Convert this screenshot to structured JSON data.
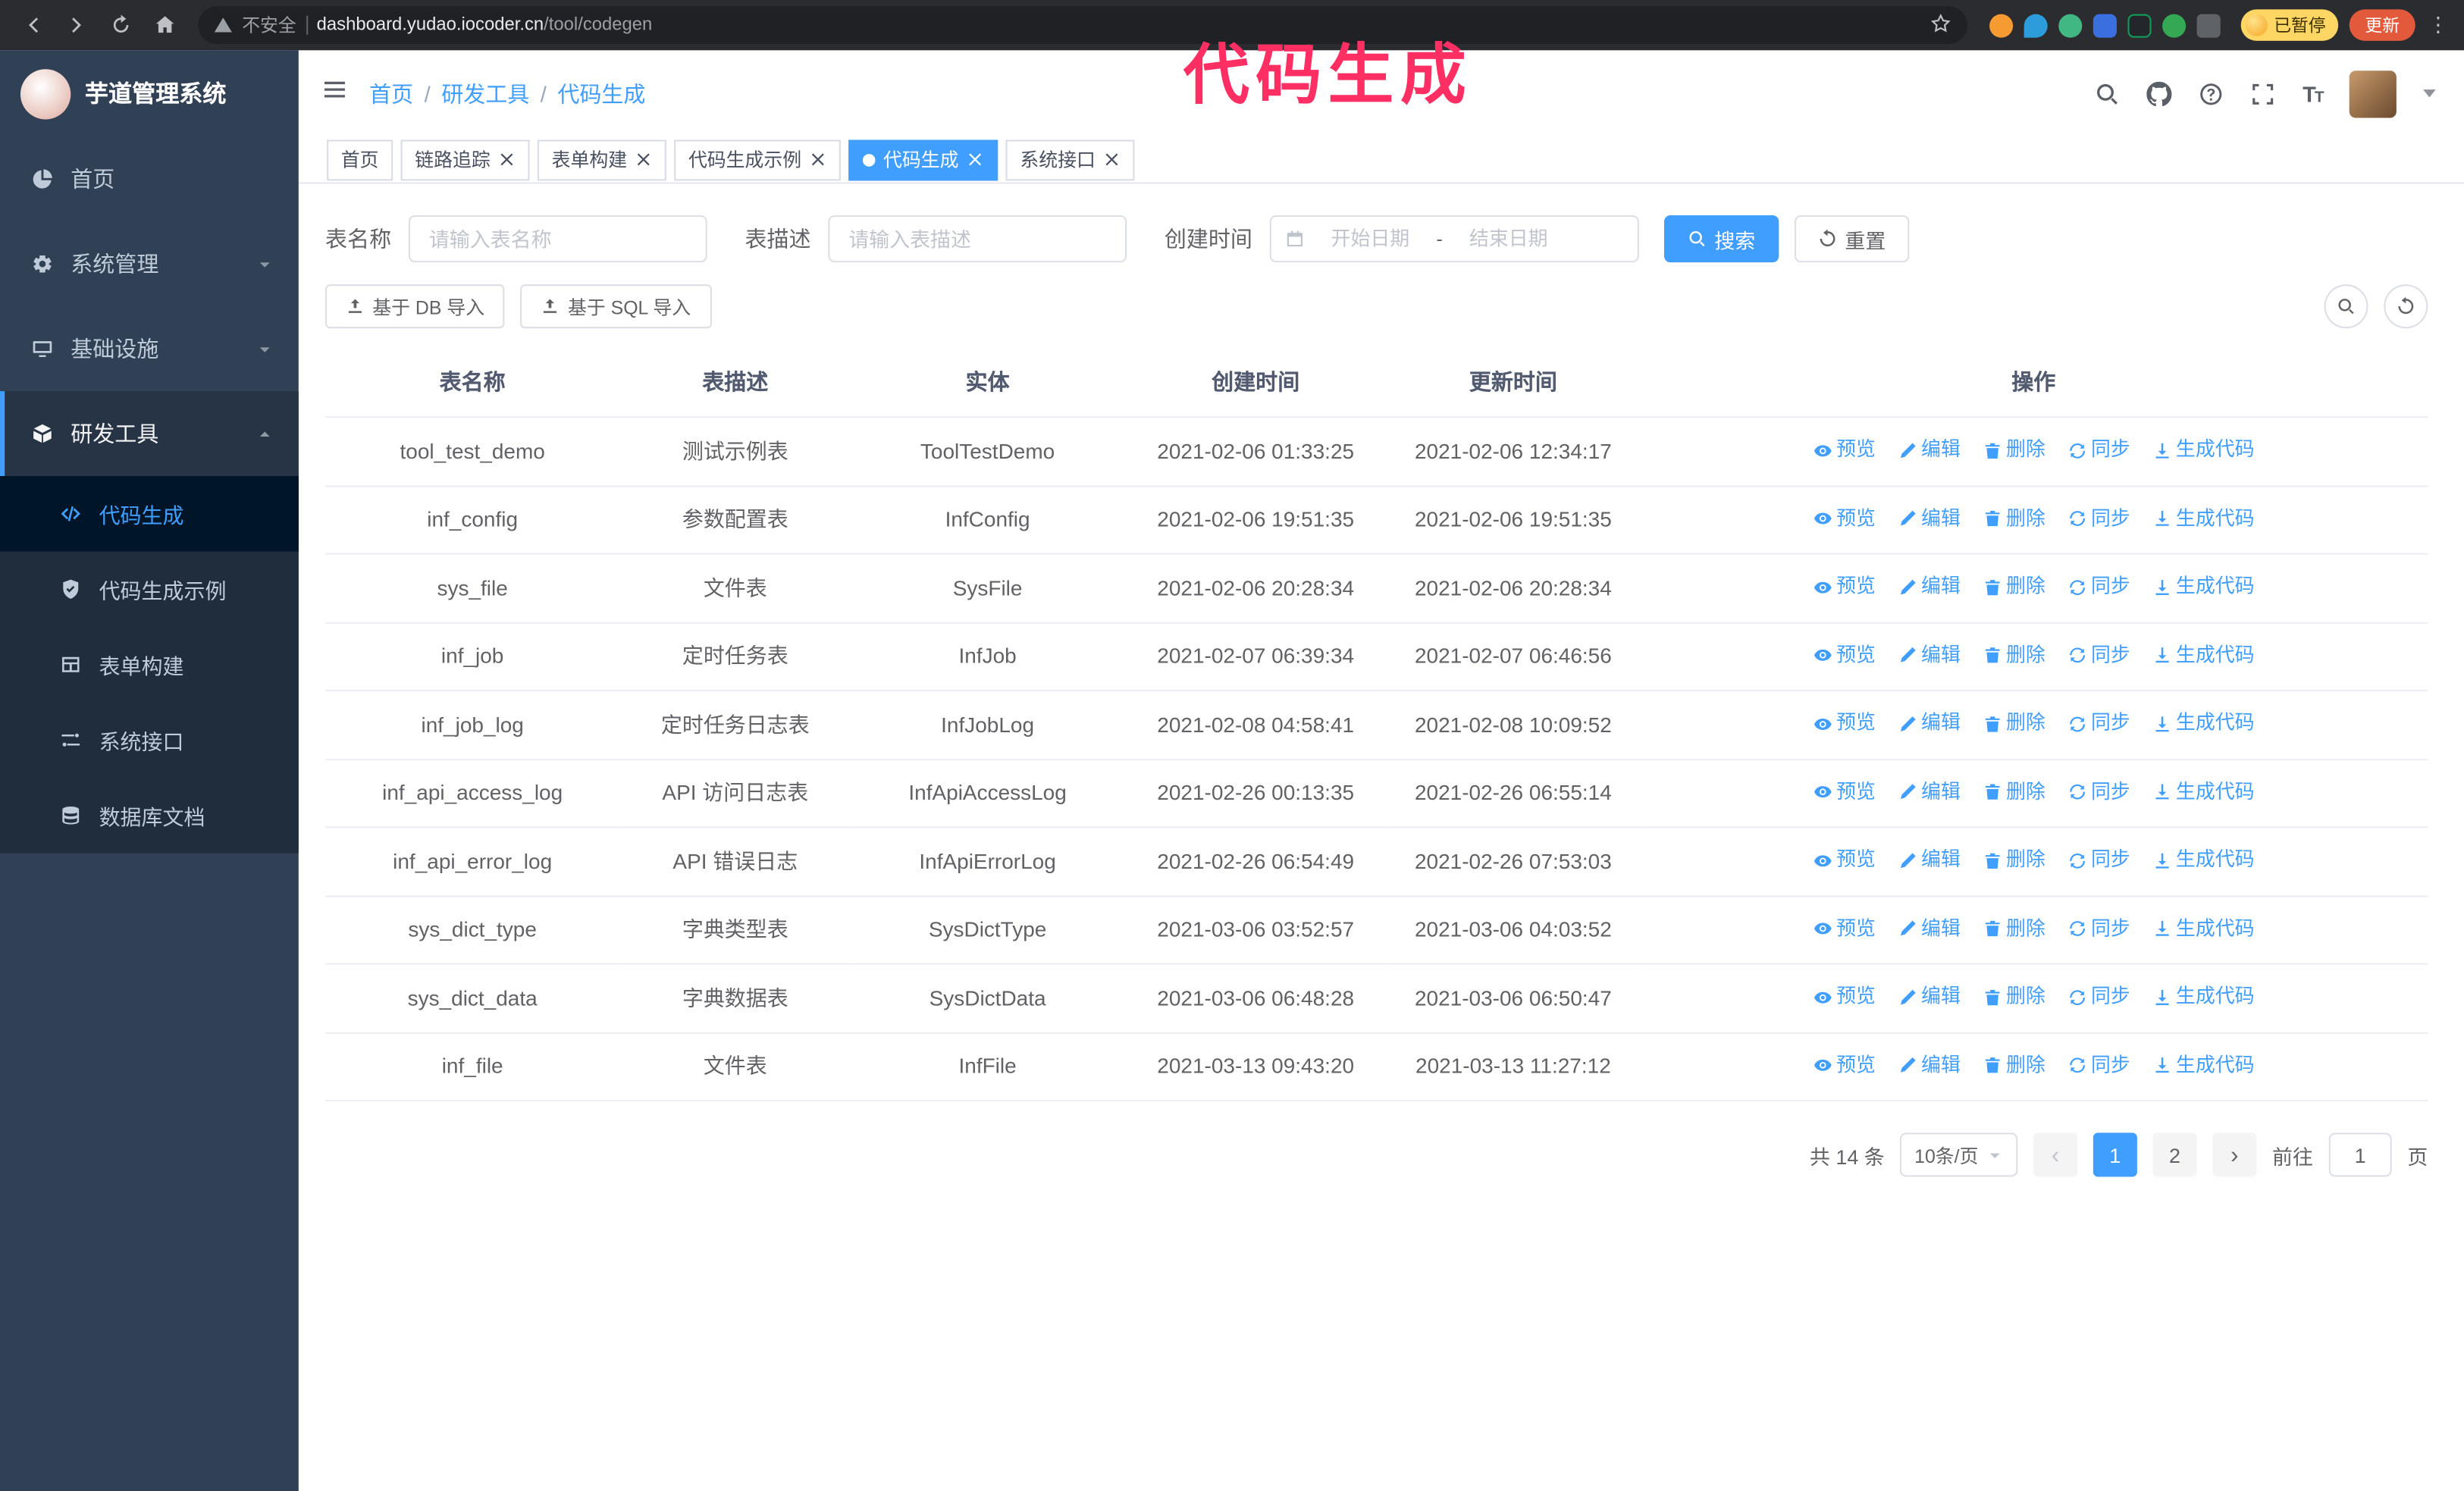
{
  "annotation": {
    "text": "代码生成"
  },
  "browser": {
    "security_label": "不安全",
    "url_domain": "dashboard.yudao.iocoder.cn",
    "url_path": "/tool/codegen",
    "paused_badge": "已暂停",
    "update_button": "更新"
  },
  "sidebar": {
    "logo_title": "芋道管理系统",
    "items": [
      {
        "label": "首页"
      },
      {
        "label": "系统管理"
      },
      {
        "label": "基础设施"
      },
      {
        "label": "研发工具"
      }
    ],
    "submenu": [
      {
        "label": "代码生成"
      },
      {
        "label": "代码生成示例"
      },
      {
        "label": "表单构建"
      },
      {
        "label": "系统接口"
      },
      {
        "label": "数据库文档"
      }
    ]
  },
  "header": {
    "breadcrumb": [
      "首页",
      "研发工具",
      "代码生成"
    ]
  },
  "tabs": [
    {
      "label": "首页"
    },
    {
      "label": "链路追踪"
    },
    {
      "label": "表单构建"
    },
    {
      "label": "代码生成示例"
    },
    {
      "label": "代码生成"
    },
    {
      "label": "系统接口"
    }
  ],
  "filters": {
    "table_name_label": "表名称",
    "table_name_placeholder": "请输入表名称",
    "table_desc_label": "表描述",
    "table_desc_placeholder": "请输入表描述",
    "create_time_label": "创建时间",
    "date_start_placeholder": "开始日期",
    "date_separator": "-",
    "date_end_placeholder": "结束日期",
    "search_button": "搜索",
    "reset_button": "重置"
  },
  "toolbar": {
    "import_db_button": "基于 DB 导入",
    "import_sql_button": "基于 SQL 导入"
  },
  "table": {
    "columns": [
      "表名称",
      "表描述",
      "实体",
      "创建时间",
      "更新时间",
      "操作"
    ],
    "actions": [
      "预览",
      "编辑",
      "删除",
      "同步",
      "生成代码"
    ],
    "rows": [
      {
        "name": "tool_test_demo",
        "desc": "测试示例表",
        "entity": "ToolTestDemo",
        "created": "2021-02-06 01:33:25",
        "updated": "2021-02-06 12:34:17"
      },
      {
        "name": "inf_config",
        "desc": "参数配置表",
        "entity": "InfConfig",
        "created": "2021-02-06 19:51:35",
        "updated": "2021-02-06 19:51:35"
      },
      {
        "name": "sys_file",
        "desc": "文件表",
        "entity": "SysFile",
        "created": "2021-02-06 20:28:34",
        "updated": "2021-02-06 20:28:34"
      },
      {
        "name": "inf_job",
        "desc": "定时任务表",
        "entity": "InfJob",
        "created": "2021-02-07 06:39:34",
        "updated": "2021-02-07 06:46:56"
      },
      {
        "name": "inf_job_log",
        "desc": "定时任务日志表",
        "entity": "InfJobLog",
        "created": "2021-02-08 04:58:41",
        "updated": "2021-02-08 10:09:52"
      },
      {
        "name": "inf_api_access_log",
        "desc": "API 访问日志表",
        "entity": "InfApiAccessLog",
        "created": "2021-02-26 00:13:35",
        "updated": "2021-02-26 06:55:14"
      },
      {
        "name": "inf_api_error_log",
        "desc": "API 错误日志",
        "entity": "InfApiErrorLog",
        "created": "2021-02-26 06:54:49",
        "updated": "2021-02-26 07:53:03"
      },
      {
        "name": "sys_dict_type",
        "desc": "字典类型表",
        "entity": "SysDictType",
        "created": "2021-03-06 03:52:57",
        "updated": "2021-03-06 04:03:52"
      },
      {
        "name": "sys_dict_data",
        "desc": "字典数据表",
        "entity": "SysDictData",
        "created": "2021-03-06 06:48:28",
        "updated": "2021-03-06 06:50:47"
      },
      {
        "name": "inf_file",
        "desc": "文件表",
        "entity": "InfFile",
        "created": "2021-03-13 09:43:20",
        "updated": "2021-03-13 11:27:12"
      }
    ]
  },
  "pagination": {
    "total_label": "共 14 条",
    "page_size": "10条/页",
    "pages": [
      "1",
      "2"
    ],
    "goto_label": "前往",
    "goto_value": "1",
    "goto_suffix": "页"
  },
  "colors": {
    "primary": "#409eff",
    "sidebar_bg": "#304156",
    "active_submenu_bg": "#001528",
    "annotation": "#ff2e63",
    "chrome_bg": "#2b2c2f",
    "paused_badge_bg": "#fdd663",
    "update_button_bg": "#e2593c"
  }
}
